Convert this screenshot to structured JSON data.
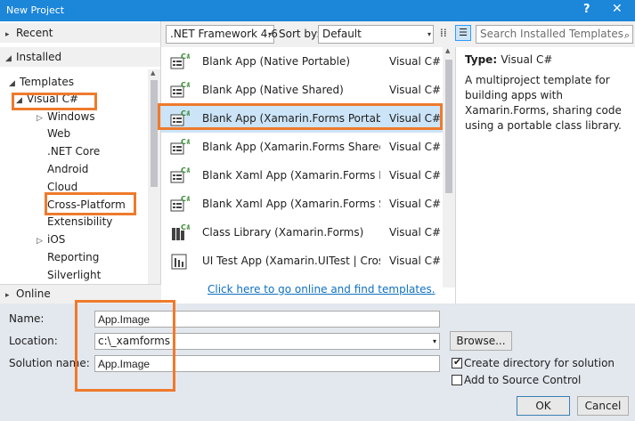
{
  "window": {
    "title": "New Project",
    "help_label": "?",
    "close_label": "✕"
  },
  "tree": {
    "recent": "Recent",
    "installed": "Installed",
    "templates": "Templates",
    "visual_csharp": "Visual C#",
    "children": [
      "Windows",
      "Web",
      ".NET Core",
      "Android",
      "Cloud",
      "Cross-Platform",
      "Extensibility",
      "iOS",
      "Reporting",
      "Silverlight"
    ],
    "online": "Online"
  },
  "filter": {
    "framework": ".NET Framework 4.6",
    "sort_label": "Sort by:",
    "sort_value": "Default",
    "search_placeholder": "Search Installed Templates"
  },
  "templates": [
    {
      "name": "Blank App (Native Portable)",
      "lang": "Visual C#",
      "icon": "csharp-app-icon"
    },
    {
      "name": "Blank App (Native Shared)",
      "lang": "Visual C#",
      "icon": "csharp-app-icon"
    },
    {
      "name": "Blank App (Xamarin.Forms Portable)",
      "lang": "Visual C#",
      "icon": "csharp-app-icon"
    },
    {
      "name": "Blank App (Xamarin.Forms Shared)",
      "lang": "Visual C#",
      "icon": "csharp-app-icon"
    },
    {
      "name": "Blank Xaml App (Xamarin.Forms Port…",
      "lang": "Visual C#",
      "icon": "csharp-app-icon"
    },
    {
      "name": "Blank Xaml App (Xamarin.Forms Sha…",
      "lang": "Visual C#",
      "icon": "csharp-app-icon"
    },
    {
      "name": "Class Library (Xamarin.Forms)",
      "lang": "Visual C#",
      "icon": "csharp-library-icon"
    },
    {
      "name": "UI Test App (Xamarin.UITest | Cross-P…",
      "lang": "Visual C#",
      "icon": "ui-test-icon"
    }
  ],
  "online_link": "Click here to go online and find templates.",
  "description": {
    "type_label": "Type:",
    "type_value": "Visual C#",
    "text": "A multiproject template for building apps with Xamarin.Forms, sharing code using a portable class library."
  },
  "form": {
    "name_label": "Name:",
    "name_value": "App.Image",
    "location_label": "Location:",
    "location_value": "c:\\_xamforms",
    "solution_label": "Solution name:",
    "solution_value": "App.Image",
    "browse_label": "Browse...",
    "create_dir_label": "Create directory for solution",
    "create_dir_checked": true,
    "source_control_label": "Add to Source Control",
    "source_control_checked": false,
    "ok_label": "OK",
    "cancel_label": "Cancel"
  },
  "colors": {
    "title_bar": "#1c86d9",
    "highlight": "#ee7a2c",
    "link": "#0e70c0"
  }
}
